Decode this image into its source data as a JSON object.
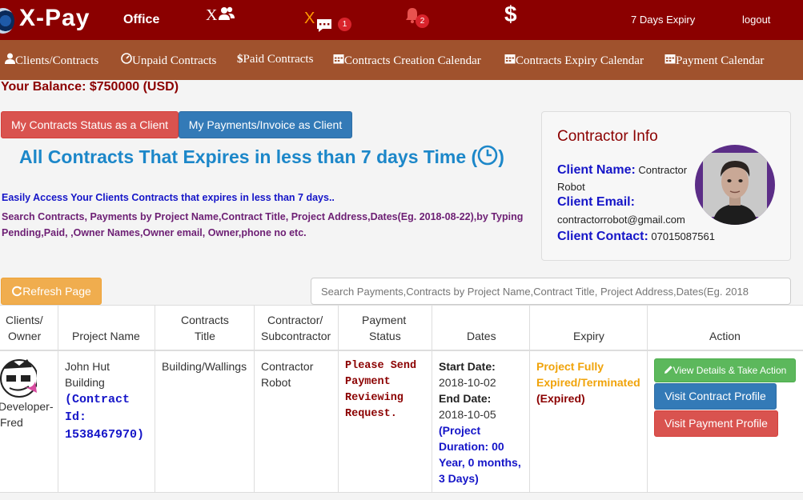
{
  "topbar": {
    "brand": "X-Pay",
    "office": "Office",
    "users_x": "X",
    "chat_x": "X",
    "chat_badge": "1",
    "bell_badge": "2",
    "dollar": "$",
    "expiry": "7 Days Expiry",
    "logout": "logout"
  },
  "nav": {
    "items": [
      {
        "icon": "user-icon",
        "label": "Clients/Contracts"
      },
      {
        "icon": "dashboard-icon",
        "label": "Unpaid Contracts"
      },
      {
        "icon": "dollar-icon",
        "label": "Paid Contracts"
      },
      {
        "icon": "calendar-icon",
        "label": "Contracts Creation Calendar"
      },
      {
        "icon": "calendar-icon",
        "label": "Contracts Expiry Calendar"
      },
      {
        "icon": "calendar-icon",
        "label": "Payment Calendar"
      }
    ]
  },
  "balance": "Your Balance: $750000 (USD)",
  "buttons": {
    "contracts_status": "My Contracts Status as a Client",
    "payments_invoice": "My Payments/Invoice as Client",
    "refresh": "Refresh Page",
    "view_details": "View Details & Take Action",
    "contract_profile": "Visit Contract Profile",
    "payment_profile": "Visit Payment Profile"
  },
  "heading": "All Contracts That Expires in less than 7 days Time (",
  "heading_close": ")",
  "intro": {
    "line1": "Easily Access Your Clients Contracts that expires in less than 7 days..",
    "line2": "Search Contracts, Payments by Project Name,Contract Title, Project Address,Dates(Eg. 2018-08-22),by Typing Pending,Paid, ,Owner Names,Owner email, Owner,phone no etc."
  },
  "contractor": {
    "title": "Contractor Info",
    "name_label": "Client Name:",
    "name": "Contractor Robot",
    "email_label": "Client Email:",
    "email": "contractorrobot@gmail.com",
    "contact_label": "Client Contact:",
    "contact": "07015087561"
  },
  "search": {
    "placeholder": "Search Payments,Contracts by Project Name,Contract Title, Project Address,Dates(Eg. 2018"
  },
  "table": {
    "headers": {
      "owner_1": "Clients/",
      "owner_2": "Owner",
      "project": "Project Name",
      "title_1": "Contracts",
      "title_2": "Title",
      "contractor_1": "Contractor/",
      "contractor_2": "Subcontractor",
      "payment_1": "Payment",
      "payment_2": "Status",
      "dates": "Dates",
      "expiry": "Expiry",
      "action": "Action"
    },
    "row": {
      "owner_1": "Developer-",
      "owner_2": "Fred",
      "project_1": "John Hut",
      "project_2": "Building",
      "contract_id_1": "(Contract",
      "contract_id_2": "Id:",
      "contract_id_3": "1538467970)",
      "title": "Building/Wallings",
      "contractor_1": "Contractor",
      "contractor_2": "Robot",
      "payment_1": "Please Send",
      "payment_2": "Payment",
      "payment_3": "Reviewing",
      "payment_4": "Request.",
      "start_label": "Start Date:",
      "start_date": "2018-10-02",
      "end_label": "End Date:",
      "end_date": "2018-10-05",
      "duration_1": "(Project",
      "duration_2": "Duration: 00",
      "duration_3": "Year, 0 months,",
      "duration_4": "3 Days)",
      "expiry_1": "Project Fully",
      "expiry_2": "Expired/Terminated",
      "expiry_3": "(Expired)"
    }
  },
  "colors": {
    "topbar": "#8b0000",
    "navbar": "#a0522d",
    "heading": "#1c87c9",
    "label_blue": "#1515c8",
    "expiry_orange": "#f0a30a"
  }
}
